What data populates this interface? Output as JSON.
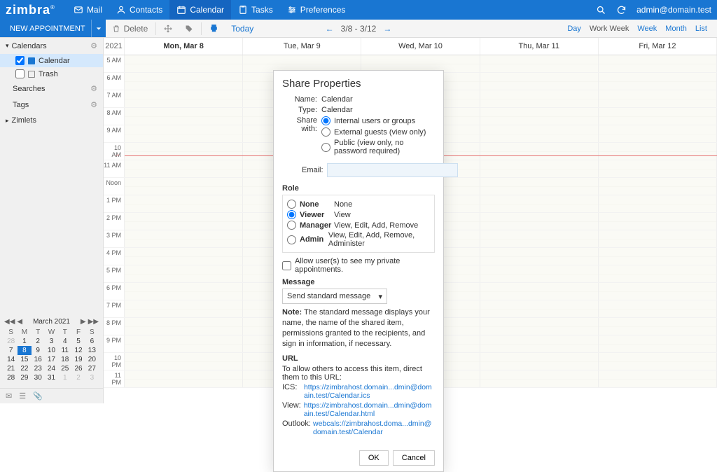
{
  "app": {
    "logo_a": "zimbra",
    "user": "admin@domain.test"
  },
  "topnav": {
    "mail": "Mail",
    "contacts": "Contacts",
    "calendar": "Calendar",
    "tasks": "Tasks",
    "prefs": "Preferences"
  },
  "toolbar": {
    "new": "NEW APPOINTMENT",
    "delete": "Delete",
    "today": "Today",
    "range": "3/8 - 3/12",
    "views": {
      "day": "Day",
      "wweek": "Work Week",
      "week": "Week",
      "month": "Month",
      "list": "List"
    }
  },
  "sidebar": {
    "calendars": "Calendars",
    "cal_item": "Calendar",
    "trash": "Trash",
    "searches": "Searches",
    "tags": "Tags",
    "zimlets": "Zimlets"
  },
  "calhdr": {
    "year": "2021",
    "days": [
      "Mon, Mar 8",
      "Tue, Mar 9",
      "Wed, Mar 10",
      "Thu, Mar 11",
      "Fri, Mar 12"
    ]
  },
  "hours": [
    "5 AM",
    "6 AM",
    "7 AM",
    "8 AM",
    "9 AM",
    "10 AM",
    "11 AM",
    "Noon",
    "1 PM",
    "2 PM",
    "3 PM",
    "4 PM",
    "5 PM",
    "6 PM",
    "7 PM",
    "8 PM",
    "9 PM",
    "10 PM",
    "11 PM"
  ],
  "minical": {
    "title": "March 2021",
    "dow": [
      "S",
      "M",
      "T",
      "W",
      "T",
      "F",
      "S"
    ],
    "weeks": [
      [
        {
          "d": 28,
          "dim": 1
        },
        {
          "d": 1
        },
        {
          "d": 2
        },
        {
          "d": 3
        },
        {
          "d": 4
        },
        {
          "d": 5
        },
        {
          "d": 6
        }
      ],
      [
        {
          "d": 7
        },
        {
          "d": 8,
          "today": 1
        },
        {
          "d": 9
        },
        {
          "d": 10
        },
        {
          "d": 11
        },
        {
          "d": 12
        },
        {
          "d": 13
        }
      ],
      [
        {
          "d": 14
        },
        {
          "d": 15
        },
        {
          "d": 16
        },
        {
          "d": 17
        },
        {
          "d": 18
        },
        {
          "d": 19
        },
        {
          "d": 20
        }
      ],
      [
        {
          "d": 21
        },
        {
          "d": 22
        },
        {
          "d": 23
        },
        {
          "d": 24
        },
        {
          "d": 25
        },
        {
          "d": 26
        },
        {
          "d": 27
        }
      ],
      [
        {
          "d": 28
        },
        {
          "d": 29
        },
        {
          "d": 30
        },
        {
          "d": 31
        },
        {
          "d": 1,
          "dim": 1
        },
        {
          "d": 2,
          "dim": 1
        },
        {
          "d": 3,
          "dim": 1
        }
      ]
    ]
  },
  "dialog": {
    "title": "Share Properties",
    "name_lbl": "Name:",
    "name_val": "Calendar",
    "type_lbl": "Type:",
    "type_val": "Calendar",
    "share_lbl": "Share with:",
    "sw_internal": "Internal users or groups",
    "sw_external": "External guests (view only)",
    "sw_public": "Public (view only, no password required)",
    "email_lbl": "Email:",
    "role_lbl": "Role",
    "roles": {
      "none": {
        "n": "None",
        "d": "None"
      },
      "viewer": {
        "n": "Viewer",
        "d": "View"
      },
      "manager": {
        "n": "Manager",
        "d": "View, Edit, Add, Remove"
      },
      "admin": {
        "n": "Admin",
        "d": "View, Edit, Add, Remove, Administer"
      }
    },
    "priv_chk": "Allow user(s) to see my private appointments.",
    "msg_lbl": "Message",
    "msg_select": "Send standard message",
    "note_b": "Note:",
    "note": " The standard message displays your name, the name of the shared item, permissions granted to the recipients, and sign in information, if necessary.",
    "url_lbl": "URL",
    "url_intro": "To allow others to access this item, direct them to this URL:",
    "url_ics_l": "ICS:",
    "url_ics": "https://zimbrahost.domain...dmin@domain.test/Calendar.ics",
    "url_view_l": "View:",
    "url_view": "https://zimbrahost.domain...dmin@domain.test/Calendar.html",
    "url_out_l": "Outlook:",
    "url_out": "webcals://zimbrahost.doma...dmin@domain.test/Calendar",
    "ok": "OK",
    "cancel": "Cancel"
  }
}
